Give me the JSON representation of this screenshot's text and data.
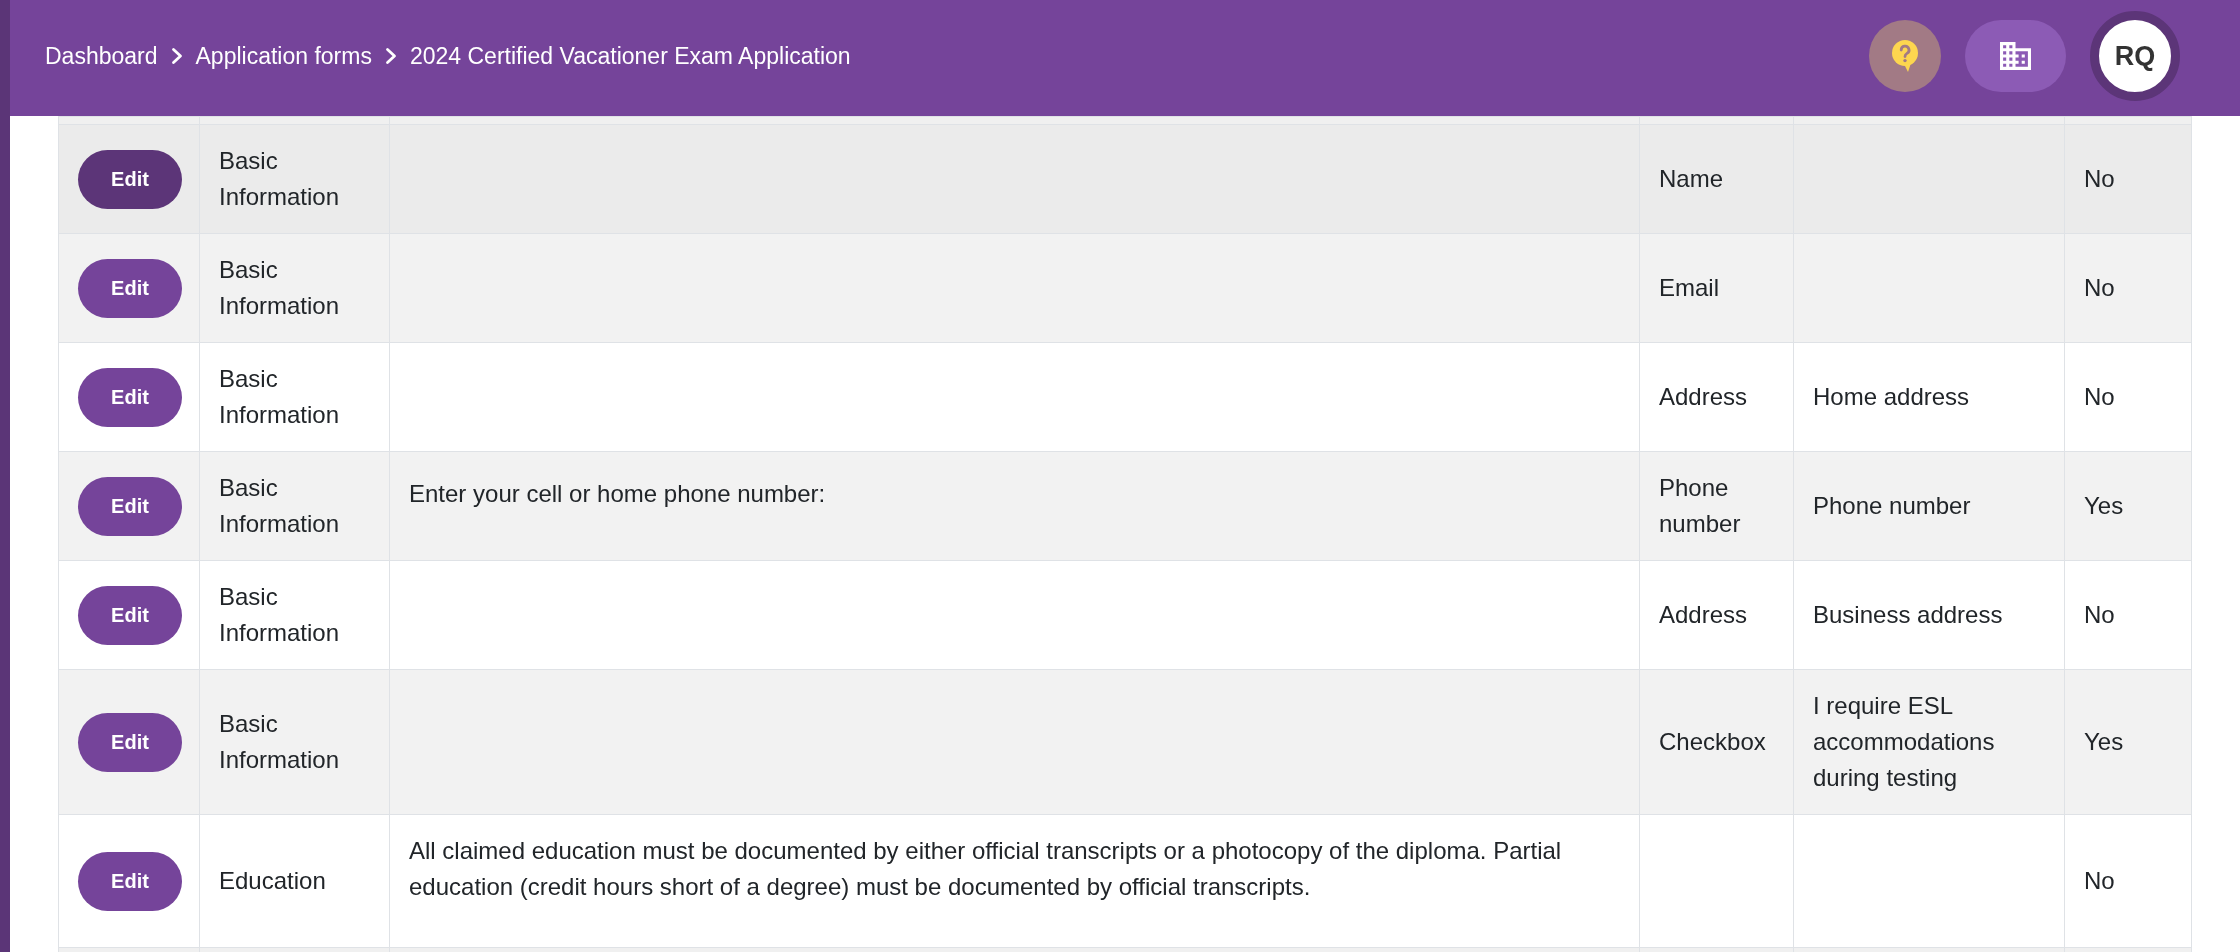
{
  "breadcrumbs": [
    "Dashboard",
    "Application forms",
    "2024 Certified Vacationer Exam Application"
  ],
  "user": {
    "initials": "RQ"
  },
  "table": {
    "rows": [
      {
        "hovered": true,
        "button": "Edit",
        "column_2": "Basic Information",
        "column_4": "Name",
        "column_6": "No"
      },
      {
        "hovered": false,
        "button": "Edit",
        "column_2": "Basic Information",
        "column_4": "Email",
        "column_6": "No"
      },
      {
        "hovered": false,
        "button": "Edit",
        "column_2": "Basic Information",
        "column_4": "Address",
        "column_5": "Home address",
        "column_6": "No"
      },
      {
        "hovered": false,
        "button": "Edit",
        "column_2": "Basic Information",
        "column_3": "Enter your cell or home phone number:",
        "column_4": "Phone number",
        "column_5": "Phone number",
        "column_6": "Yes"
      },
      {
        "hovered": false,
        "button": "Edit",
        "column_2": "Basic Information",
        "column_4": "Address",
        "column_5": "Business address",
        "column_6": "No"
      },
      {
        "hovered": false,
        "button": "Edit",
        "column_2": "Basic Information",
        "column_4": "Checkbox",
        "column_5": "I require ESL accommodations during testing",
        "column_6": "Yes"
      },
      {
        "hovered": false,
        "button": "Edit",
        "column_2": "Education",
        "column_3": "All claimed education must be documented by either official transcripts or a photocopy of the diploma. Partial education (credit hours short of a degree) must be documented by official transcripts.",
        "column_6": "No"
      }
    ]
  }
}
